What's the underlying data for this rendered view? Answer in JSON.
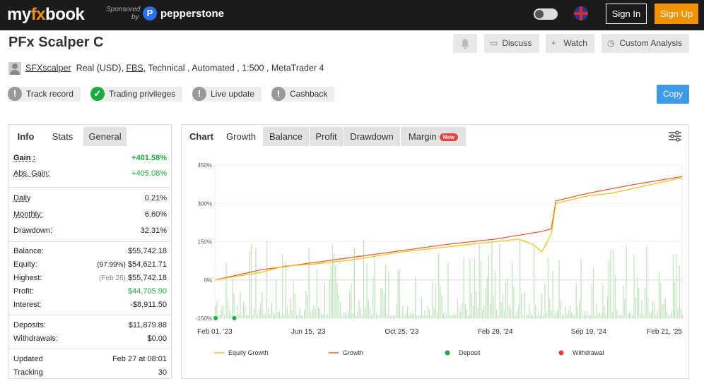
{
  "header": {
    "logo_part1": "my",
    "logo_part2": "fx",
    "logo_part3": "book",
    "sponsored_line1": "Sponsored",
    "sponsored_line2": "by",
    "sponsor_icon_letter": "P",
    "sponsor_name": "pepperstone",
    "signin_label": "Sign In",
    "signup_label": "Sign Up"
  },
  "system": {
    "title": "PFx Scalper C",
    "buttons": {
      "discuss": "Discuss",
      "watch": "Watch",
      "custom": "Custom Analysis"
    },
    "user": "SFXscalper",
    "account_type": "Real (USD),",
    "broker": "FBS",
    "details": ", Technical , Automated , 1:500 , MetaTrader 4"
  },
  "badges": {
    "track_record": "Track record",
    "trading_privileges": "Trading privileges",
    "live_update": "Live update",
    "cashback": "Cashback",
    "icon_excl": "!",
    "icon_check": "✓"
  },
  "copy_label": "Copy",
  "stats_tabs": {
    "info": "Info",
    "stats": "Stats",
    "general": "General"
  },
  "stats": {
    "gain_label": "Gain :",
    "gain": "+401.58%",
    "abs_gain_label": "Abs. Gain:",
    "abs_gain": "+405.08%",
    "daily_label": "Daily",
    "daily": "0.21%",
    "monthly_label": "Monthly:",
    "monthly": "6.60%",
    "drawdown_label": "Drawdown:",
    "drawdown": "32.31%",
    "balance_label": "Balance:",
    "balance": "$55,742.18",
    "equity_label": "Equity:",
    "equity_pct": "(97.99%)",
    "equity": "$54,621.71",
    "highest_label": "Highest:",
    "highest_date": "(Feb 26)",
    "highest": "$55,742.18",
    "profit_label": "Profit:",
    "profit": "$44,705.90",
    "interest_label": "Interest:",
    "interest": "-$8,911.50",
    "deposits_label": "Deposits:",
    "deposits": "$11,879.88",
    "withdrawals_label": "Withdrawals:",
    "withdrawals": "$0.00",
    "updated_label": "Updated",
    "updated": "Feb 27 at 08:01",
    "tracking_label": "Tracking",
    "tracking": "30"
  },
  "chart_tabs": {
    "chart": "Chart",
    "growth": "Growth",
    "balance": "Balance",
    "profit": "Profit",
    "drawdown": "Drawdown",
    "margin": "Margin",
    "new_badge": "New"
  },
  "chart_data": {
    "type": "line",
    "title": "",
    "x_ticks": [
      "Feb 01, '23",
      "Jun 15, '23",
      "Oct 25, '23",
      "Feb 28, '24",
      "Sep 19, '24",
      "Feb 21, '25"
    ],
    "y_ticks": [
      "450%",
      "300%",
      "150%",
      "0%",
      "-150%"
    ],
    "ylim": [
      -150,
      450
    ],
    "legend": [
      "Equity Growth",
      "Growth",
      "Deposit",
      "Withdrawal"
    ],
    "series": [
      {
        "name": "Growth",
        "color": "#e8603c",
        "x": [
          0,
          0.1,
          0.2,
          0.3,
          0.4,
          0.5,
          0.6,
          0.7,
          0.72,
          0.73,
          0.8,
          0.9,
          1.0
        ],
        "y": [
          0,
          40,
          65,
          90,
          115,
          140,
          160,
          190,
          200,
          310,
          340,
          375,
          405
        ]
      },
      {
        "name": "Equity Growth",
        "color": "#f0c419",
        "x": [
          0,
          0.1,
          0.15,
          0.2,
          0.3,
          0.4,
          0.5,
          0.6,
          0.65,
          0.68,
          0.7,
          0.72,
          0.73,
          0.8,
          0.85,
          0.9,
          1.0
        ],
        "y": [
          0,
          30,
          55,
          60,
          80,
          110,
          130,
          150,
          160,
          140,
          110,
          180,
          300,
          330,
          340,
          360,
          400
        ]
      }
    ],
    "deposits_x": [
      0.0,
      0.04
    ],
    "colors": {
      "growth": "#e8603c",
      "equity": "#f0c419",
      "deposit": "#1bab3b",
      "withdrawal": "#e8403e",
      "bars": "#9fd89a"
    }
  }
}
